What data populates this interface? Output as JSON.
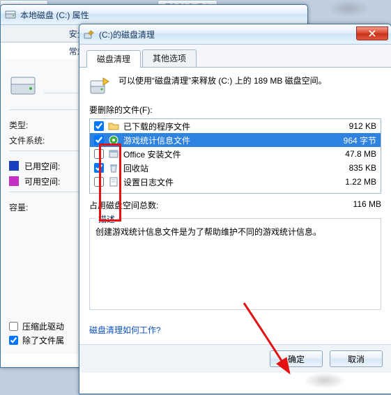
{
  "ghost_tabs": {
    "a": "磁盘 (C:)",
    "b": "TOOLS (D:)"
  },
  "back": {
    "title": "本地磁盘 (C:) 属性",
    "tab_security": "安全",
    "tab_general": "常规",
    "type_label": "类型:",
    "fs_label": "文件系统:",
    "used_label": "已用空间:",
    "free_label": "可用空间:",
    "capacity_label": "容量:",
    "chk_compress": "压缩此驱动",
    "chk_index": "除了文件属"
  },
  "dlg": {
    "title": "(C:)的磁盘清理",
    "tab_cleanup": "磁盘清理",
    "tab_other": "其他选项",
    "intro": "可以使用“磁盘清理”来释放  (C:) 上的 189 MB 磁盘空间。",
    "list_label": "要删除的文件(F):",
    "files": [
      {
        "name": "已下载的程序文件",
        "size": "912 KB",
        "checked": true,
        "icon": "folder"
      },
      {
        "name": "游戏统计信息文件",
        "size": "964 字节",
        "checked": true,
        "icon": "game",
        "sel": true
      },
      {
        "name": "Office 安装文件",
        "size": "47.8 MB",
        "checked": false,
        "icon": "pkg"
      },
      {
        "name": "回收站",
        "size": "835 KB",
        "checked": true,
        "icon": "recycle"
      },
      {
        "name": "设置日志文件",
        "size": "1.22 MB",
        "checked": false,
        "icon": "doc"
      }
    ],
    "total_label": "占用磁盘空间总数:",
    "total_value": "116 MB",
    "desc_legend": "描述",
    "desc_text": "创建游戏统计信息文件是为了帮助维护不同的游戏统计信息。",
    "link": "磁盘清理如何工作?",
    "ok": "确定",
    "cancel": "取消"
  }
}
